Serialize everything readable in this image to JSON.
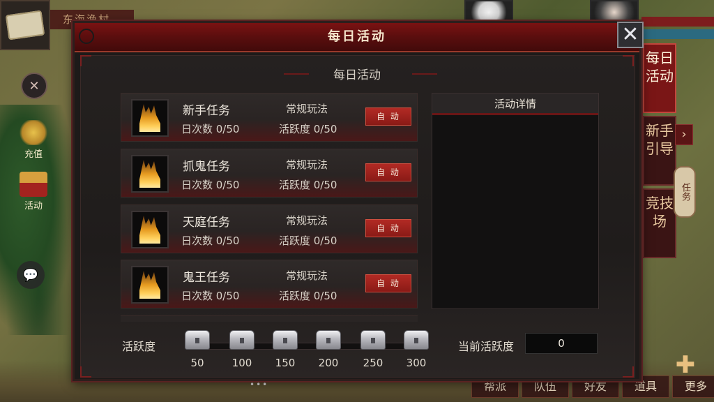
{
  "hud": {
    "location": "东海渔村",
    "side": {
      "recharge": "充值",
      "activity": "活动"
    },
    "right_tabs": [
      "每日活动",
      "新手引导",
      "竞技场"
    ],
    "task_lantern": "任务",
    "bottom_tabs": [
      "帮派",
      "队伍",
      "好友",
      "道具",
      "更多"
    ]
  },
  "dialog": {
    "title": "每日活动",
    "subtitle": "每日活动",
    "tasks": [
      {
        "name": "新手任务",
        "count": "日次数 0/50",
        "type": "常规玩法",
        "activity": "活跃度 0/50",
        "button": "自 动"
      },
      {
        "name": "抓鬼任务",
        "count": "日次数 0/50",
        "type": "常规玩法",
        "activity": "活跃度 0/50",
        "button": "自 动"
      },
      {
        "name": "天庭任务",
        "count": "日次数 0/50",
        "type": "常规玩法",
        "activity": "活跃度 0/50",
        "button": "自 动"
      },
      {
        "name": "鬼王任务",
        "count": "日次数 0/50",
        "type": "常规玩法",
        "activity": "活跃度 0/50",
        "button": "自 动"
      }
    ],
    "detail_title": "活动详情",
    "activity_label": "活跃度",
    "chests": [
      "50",
      "100",
      "150",
      "200",
      "250",
      "300"
    ],
    "current_label": "当前活跃度",
    "current_value": "0"
  },
  "colors": {
    "accent_red": "#7a1212",
    "button_red": "#b22a24",
    "panel_dark": "#1d1a19"
  }
}
